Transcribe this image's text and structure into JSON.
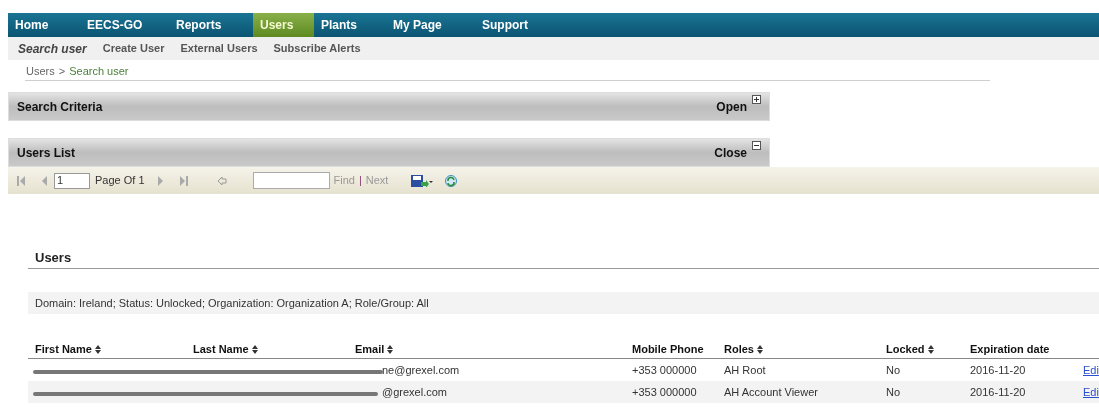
{
  "nav": {
    "items": [
      {
        "label": "Home",
        "selected": false
      },
      {
        "label": "EECS-GO",
        "selected": false
      },
      {
        "label": "Reports",
        "selected": false
      },
      {
        "label": "Users",
        "selected": true
      },
      {
        "label": "Plants",
        "selected": false
      },
      {
        "label": "My Page",
        "selected": false
      },
      {
        "label": "Support",
        "selected": false
      }
    ]
  },
  "subnav": {
    "items": [
      {
        "label": "Search user",
        "selected": true
      },
      {
        "label": "Create User",
        "selected": false
      },
      {
        "label": "External Users",
        "selected": false
      },
      {
        "label": "Subscribe Alerts",
        "selected": false
      }
    ]
  },
  "breadcrumb": {
    "parent": "Users",
    "separator": ">",
    "current": "Search user"
  },
  "panels": [
    {
      "title": "Search Criteria",
      "action": "Open",
      "expanded": false
    },
    {
      "title": "Users List",
      "action": "Close",
      "expanded": true
    }
  ],
  "toolbar": {
    "page_value": "1",
    "page_label": "Page Of 1",
    "find": "Find",
    "separator": "|",
    "next": "Next"
  },
  "users": {
    "title": "Users",
    "filter": "Domain: Ireland; Status: Unlocked; Organization: Organization A; Role/Group: All",
    "columns": [
      {
        "label": "First Name",
        "sortable": true
      },
      {
        "label": "Last Name",
        "sortable": true
      },
      {
        "label": "Email",
        "sortable": true
      },
      {
        "label": "Mobile Phone",
        "sortable": false
      },
      {
        "label": "Roles",
        "sortable": true
      },
      {
        "label": "Locked",
        "sortable": true
      },
      {
        "label": "Expiration date",
        "sortable": false
      }
    ],
    "rows": [
      {
        "email": "ne@grexel.com",
        "mobile": "+353 000000",
        "roles": "AH Root",
        "locked": "No",
        "expiration": "2016-11-20",
        "action": "Edi"
      },
      {
        "email": "@grexel.com",
        "mobile": "+353 000000",
        "roles": "AH Account Viewer",
        "locked": "No",
        "expiration": "2016-11-20",
        "action": "Edi"
      }
    ]
  }
}
